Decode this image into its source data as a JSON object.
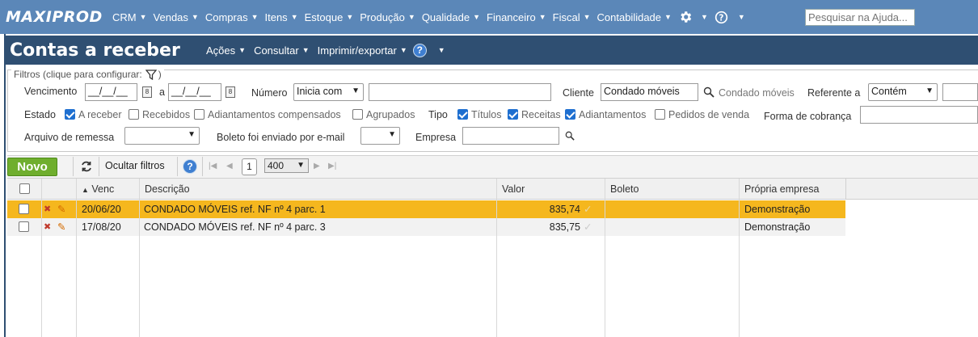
{
  "app": {
    "brand": "MAXIPROD",
    "menu": [
      "CRM",
      "Vendas",
      "Compras",
      "Itens",
      "Estoque",
      "Produção",
      "Qualidade",
      "Financeiro",
      "Fiscal",
      "Contabilidade"
    ],
    "help_search_placeholder": "Pesquisar na Ajuda..."
  },
  "page": {
    "title": "Contas a receber",
    "menu": [
      "Ações",
      "Consultar",
      "Imprimir/exportar"
    ]
  },
  "filters": {
    "legend": "Filtros (clique para configurar:",
    "legend_close": ")",
    "vencimento_label": "Vencimento",
    "date_from": "__/__/__",
    "date_to": "__/__/__",
    "a_label": "a",
    "numero_label": "Número",
    "numero_mode": "Inicia com",
    "cliente_label": "Cliente",
    "cliente_value": "Condado móveis",
    "cliente_resolved": "Condado móveis",
    "referente_label": "Referente a",
    "referente_mode": "Contém",
    "estado_label": "Estado",
    "estado_options": [
      {
        "label": "A receber",
        "checked": true
      },
      {
        "label": "Recebidos",
        "checked": false
      },
      {
        "label": "Adiantamentos compensados",
        "checked": false
      },
      {
        "label": "Agrupados",
        "checked": false
      }
    ],
    "tipo_label": "Tipo",
    "tipo_options": [
      {
        "label": "Títulos",
        "checked": true
      },
      {
        "label": "Receitas",
        "checked": true
      },
      {
        "label": "Adiantamentos",
        "checked": true
      },
      {
        "label": "Pedidos de venda",
        "checked": false
      }
    ],
    "forma_label": "Forma de cobrança",
    "arquivo_label": "Arquivo de remessa",
    "boleto_label": "Boleto foi enviado por e-mail",
    "empresa_label": "Empresa"
  },
  "toolbar": {
    "novo_label": "Novo",
    "ocultar_label": "Ocultar filtros",
    "page_number": "1",
    "page_size": "400"
  },
  "grid": {
    "columns": [
      "Venc",
      "Descrição",
      "Valor",
      "Boleto",
      "Própria empresa"
    ],
    "rows": [
      {
        "venc": "20/06/20",
        "descricao": "CONDADO MÓVEIS ref. NF nº 4 parc. 1",
        "valor": "835,74",
        "boleto": "",
        "empresa": "Demonstração",
        "selected": true
      },
      {
        "venc": "17/08/20",
        "descricao": "CONDADO MÓVEIS ref. NF nº 4 parc. 3",
        "valor": "835,75",
        "boleto": "",
        "empresa": "Demonstração",
        "selected": false
      }
    ]
  },
  "colors": {
    "topbar": "#5b87b8",
    "titlebar": "#2f4f72",
    "selected_row": "#f5b71e",
    "novo_button": "#6fae2e"
  }
}
